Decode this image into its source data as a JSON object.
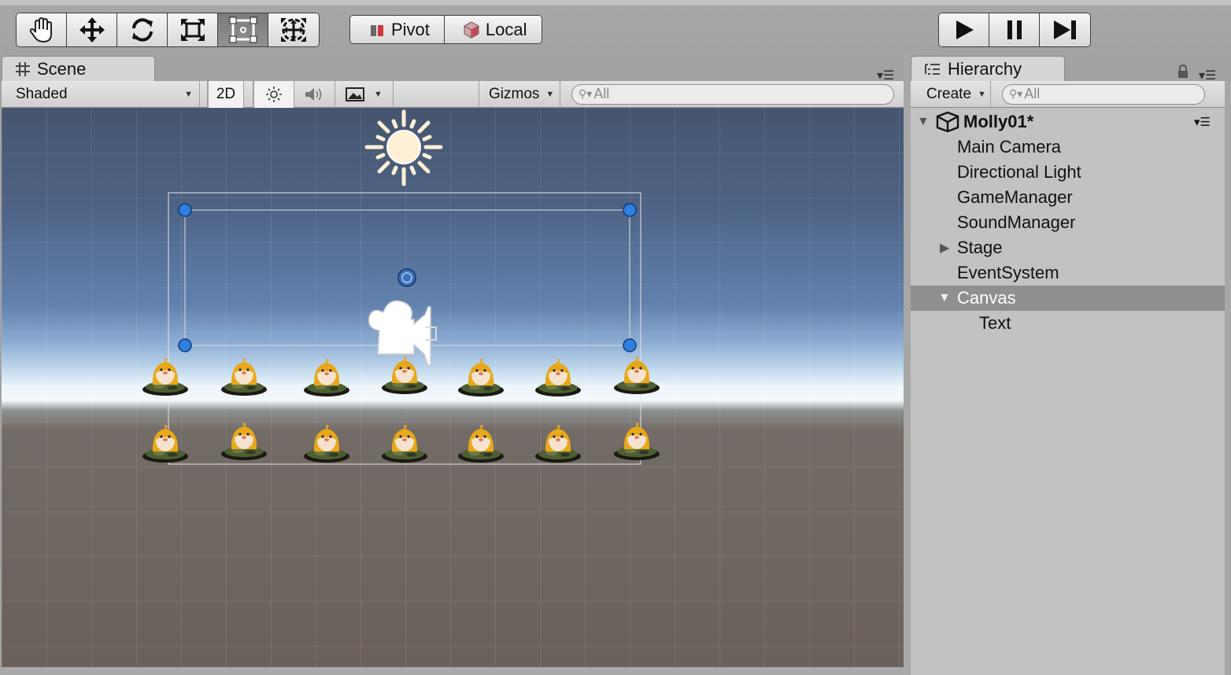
{
  "toolbar": {
    "tools": [
      {
        "name": "hand-tool-icon"
      },
      {
        "name": "move-tool-icon"
      },
      {
        "name": "rotate-tool-icon"
      },
      {
        "name": "scale-tool-icon"
      },
      {
        "name": "rect-tool-icon",
        "active": true
      },
      {
        "name": "transform-tool-icon"
      }
    ],
    "pivot_label": "Pivot",
    "local_label": "Local",
    "play_icons": [
      "play-icon",
      "pause-icon",
      "step-icon"
    ]
  },
  "scene": {
    "tab_label": "Scene",
    "shading_mode": "Shaded",
    "mode_2d": "2D",
    "gizmos_label": "Gizmos",
    "search_placeholder": "All"
  },
  "hierarchy": {
    "tab_label": "Hierarchy",
    "create_label": "Create",
    "search_placeholder": "All",
    "scene_name": "Molly01*",
    "items": [
      {
        "label": "Main Camera",
        "depth": 1
      },
      {
        "label": "Directional Light",
        "depth": 1
      },
      {
        "label": "GameManager",
        "depth": 1
      },
      {
        "label": "SoundManager",
        "depth": 1
      },
      {
        "label": "Stage",
        "depth": 1,
        "expandable": true,
        "expanded": false
      },
      {
        "label": "EventSystem",
        "depth": 1
      },
      {
        "label": "Canvas",
        "depth": 1,
        "expandable": true,
        "expanded": true,
        "selected": true
      },
      {
        "label": "Text",
        "depth": 2
      }
    ]
  },
  "colors": {
    "selection": "#8f8f8f",
    "handle_blue": "#2f7fe0",
    "sky_top": "#45556f",
    "ground": "#6b615b"
  }
}
